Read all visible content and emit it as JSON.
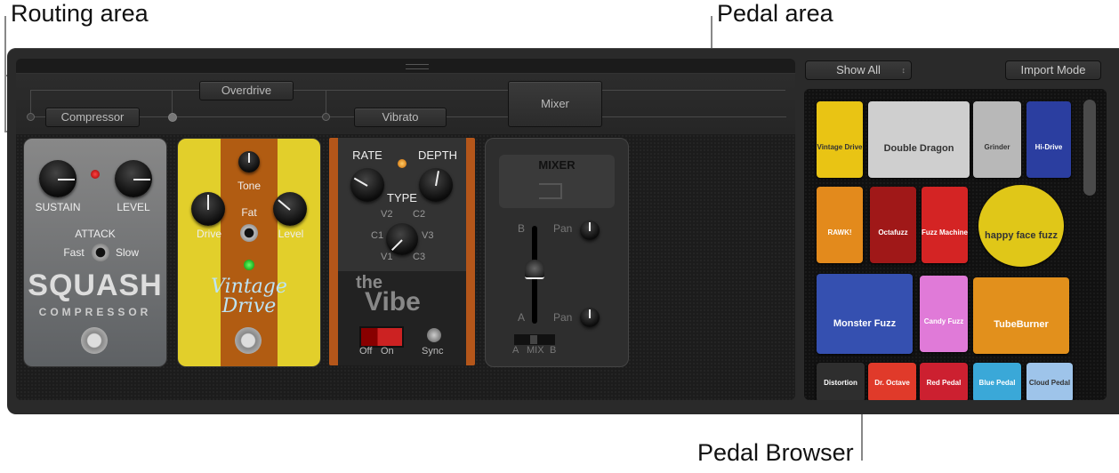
{
  "callouts": {
    "routing_area": "Routing area",
    "pedal_area": "Pedal area",
    "pedal_browser": "Pedal Browser"
  },
  "routing": {
    "slots": [
      "Compressor",
      "Overdrive",
      "Vibrato"
    ],
    "mixer_label": "Mixer"
  },
  "pedals": {
    "squash": {
      "knob1": "SUSTAIN",
      "knob2": "LEVEL",
      "switch_title": "ATTACK",
      "switch_left": "Fast",
      "switch_right": "Slow",
      "name": "SQUASH",
      "subtitle": "COMPRESSOR"
    },
    "vintage": {
      "tone": "Tone",
      "drive": "Drive",
      "level": "Level",
      "fat": "Fat",
      "name_line1": "Vintage",
      "name_line2": "Drive"
    },
    "vibe": {
      "rate": "RATE",
      "depth": "DEPTH",
      "type": "TYPE",
      "positions": [
        "V2",
        "C2",
        "C1",
        "V3",
        "V1",
        "C3"
      ],
      "name_line1": "the",
      "name_line2": "Vibe",
      "off": "Off",
      "on": "On",
      "sync": "Sync"
    },
    "mixer": {
      "title": "MIXER",
      "b": "B",
      "a": "A",
      "pan_b": "Pan",
      "pan_a": "Pan",
      "mix_a": "A",
      "mix": "MIX",
      "mix_b": "B"
    }
  },
  "browser": {
    "filter_value": "Show All",
    "import_mode": "Import Mode",
    "items": [
      {
        "name": "Vintage Drive",
        "color": "#e9c414"
      },
      {
        "name": "Double Dragon",
        "color": "#cfcfcf"
      },
      {
        "name": "Grinder",
        "color": "#b8b8b8"
      },
      {
        "name": "Hi-Drive",
        "color": "#2b3ea0"
      },
      {
        "name": "RAWK!",
        "color": "#e38a1c"
      },
      {
        "name": "Octafuzz",
        "color": "#a01818"
      },
      {
        "name": "Fuzz Machine",
        "color": "#d42424"
      },
      {
        "name": "happy face fuzz",
        "color": "#e0c718"
      },
      {
        "name": "Monster Fuzz",
        "color": "#3550b0"
      },
      {
        "name": "Candy Fuzz",
        "color": "#e07ad8"
      },
      {
        "name": "TubeBurner",
        "color": "#e2901c"
      },
      {
        "name": "Distortion",
        "color": "#2e2e2e"
      },
      {
        "name": "Dr. Octave",
        "color": "#e03a2a"
      },
      {
        "name": "Red Pedal",
        "color": "#cc2030"
      },
      {
        "name": "Blue Pedal",
        "color": "#3aa8d8"
      },
      {
        "name": "Cloud Pedal",
        "color": "#9ec4ea"
      }
    ]
  }
}
